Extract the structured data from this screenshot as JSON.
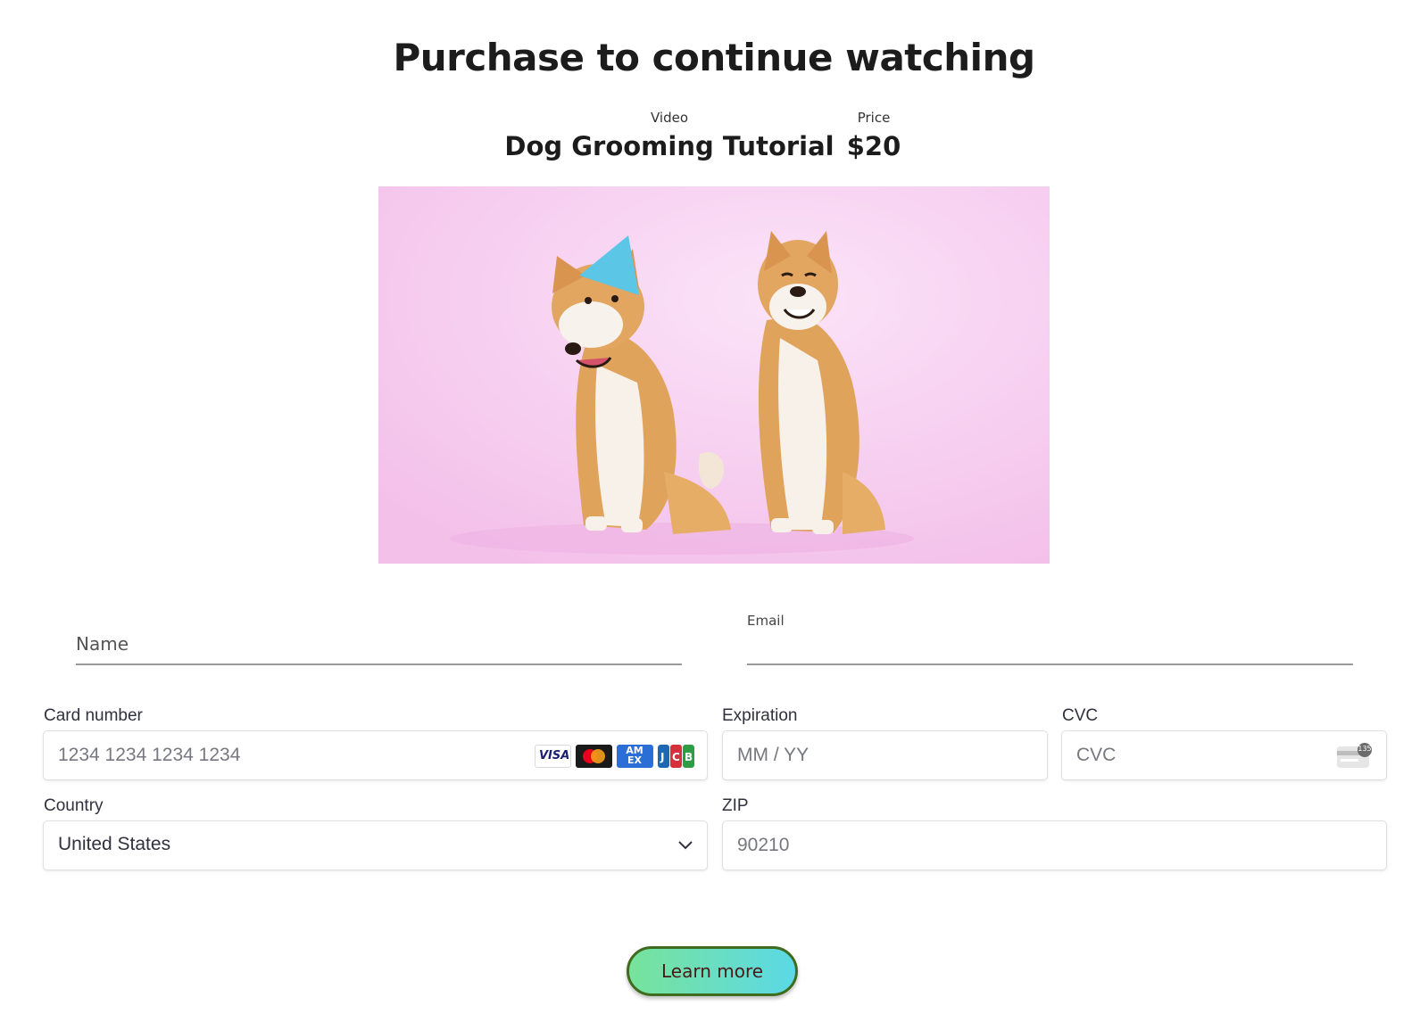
{
  "header": {
    "title": "Purchase to continue watching"
  },
  "product": {
    "video_label": "Video",
    "video_name": "Dog Grooming Tutorial",
    "price_label": "Price",
    "price_value": "$20"
  },
  "thumbnail": {
    "alt": "Two shiba inu dogs on pink background, one wearing a blue party hat"
  },
  "form": {
    "name_placeholder": "Name",
    "email_label": "Email",
    "email_value": "",
    "card_number_label": "Card number",
    "card_number_placeholder": "1234 1234 1234 1234",
    "card_brands": [
      "VISA",
      "Mastercard",
      "AMEX",
      "JCB"
    ],
    "expiration_label": "Expiration",
    "expiration_placeholder": "MM / YY",
    "cvc_label": "CVC",
    "cvc_placeholder": "CVC",
    "cvc_icon_badge": "135",
    "country_label": "Country",
    "country_value": "United States",
    "zip_label": "ZIP",
    "zip_placeholder": "90210"
  },
  "actions": {
    "learn_more_label": "Learn more"
  },
  "colors": {
    "thumbnail_bg": "#f5c6ee",
    "button_gradient_start": "#78e39b",
    "button_gradient_end": "#5bd9e6",
    "button_border": "#3f6b1f"
  }
}
